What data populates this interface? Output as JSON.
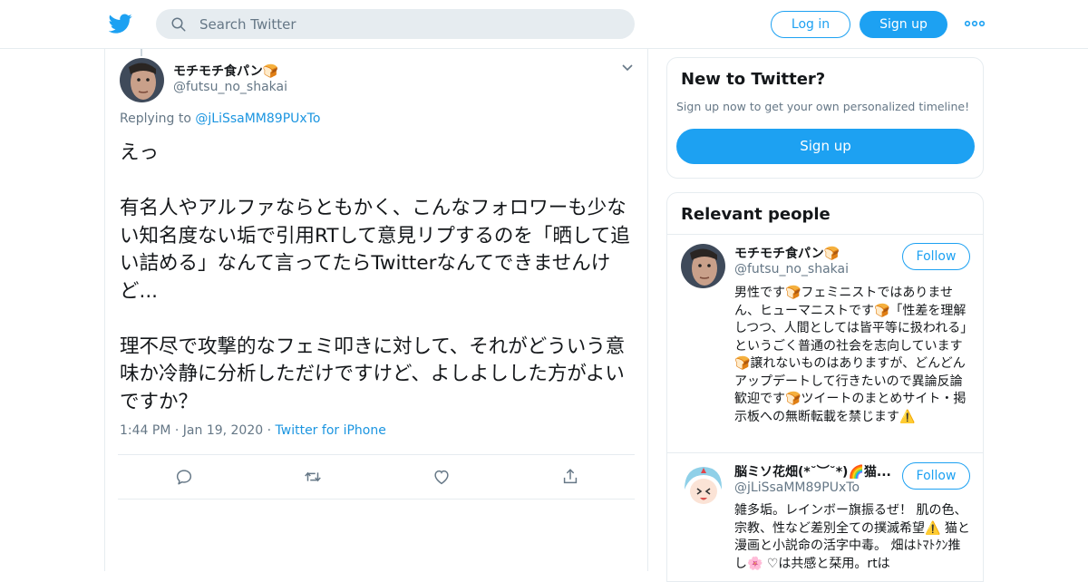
{
  "header": {
    "search_placeholder": "Search Twitter",
    "login_label": "Log in",
    "signup_label": "Sign up",
    "brand_color": "#1da1f2"
  },
  "tweet": {
    "author_name": "モチモチ食パン🍞",
    "author_handle": "@futsu_no_shakai",
    "replying_prefix": "Replying to",
    "replying_to": "@jLiSsaMM89PUxTo",
    "text": "えっ\n\n有名人やアルファならともかく、こんなフォロワーも少ない知名度ない垢で引用RTして意見リプするのを「晒して追い詰める」なんて言ってたらTwitterなんてできませんけど...\n\n理不尽で攻撃的なフェミ叩きに対して、それがどういう意味か冷静に分析しただけですけど、よしよしした方がよいですか？",
    "time": "1:44 PM",
    "date": "Jan 19, 2020",
    "source": "Twitter for iPhone",
    "actions": [
      "reply-icon",
      "retweet-icon",
      "like-icon",
      "share-icon"
    ]
  },
  "new_to_twitter": {
    "title": "New to Twitter?",
    "subtitle": "Sign up now to get your own personalized timeline!",
    "signup_label": "Sign up"
  },
  "relevant_people": {
    "title": "Relevant people",
    "people": [
      {
        "name": "モチモチ食パン🍞",
        "handle": "@futsu_no_shakai",
        "follow_label": "Follow",
        "bio": "男性です🍞フェミニストではありません、ヒューマニストです🍞「性差を理解しつつ、人間としては皆平等に扱われる」というごく普通の社会を志向しています🍞譲れないものはありますが、どんどんアップデートして行きたいので異論反論歓迎です🍞ツイートのまとめサイト・掲示板への無断転載を禁じます⚠️"
      },
      {
        "name": "脳ミソ花畑(*˘︶˘*)🌈猫...",
        "handle": "@jLiSsaMM89PUxTo",
        "follow_label": "Follow",
        "bio": "雑多垢。レインボー旗振るぜ！ 肌の色、宗教、性など差別全ての撲滅希望⚠️ 猫と漫画と小説命の活字中毒。 畑はﾄﾏﾄｸﾝ推し🌸 ♡は共感と栞用。rtは"
      }
    ]
  }
}
